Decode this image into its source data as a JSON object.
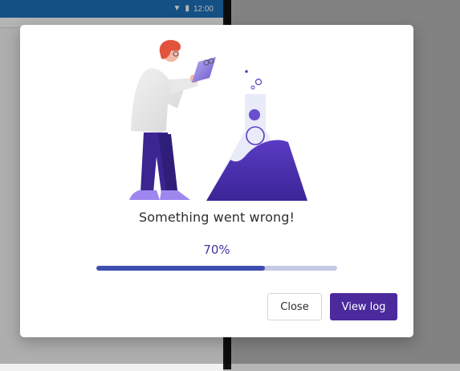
{
  "statusbar": {
    "time": "12:00",
    "wifi_icon": "wifi-icon",
    "battery_icon": "battery-icon"
  },
  "dialog": {
    "message": "Something went wrong!",
    "progress": {
      "label": "70%",
      "value": 0.7
    },
    "buttons": {
      "close": "Close",
      "view_log": "View log"
    },
    "illustration": "scientist-with-flask-illustration"
  },
  "colors": {
    "accent": "#4a2a9c",
    "progress_fill": "#3d4db0",
    "progress_track": "#c5c9e3",
    "percent_text": "#47329a",
    "statusbar": "#1e6fb8"
  }
}
